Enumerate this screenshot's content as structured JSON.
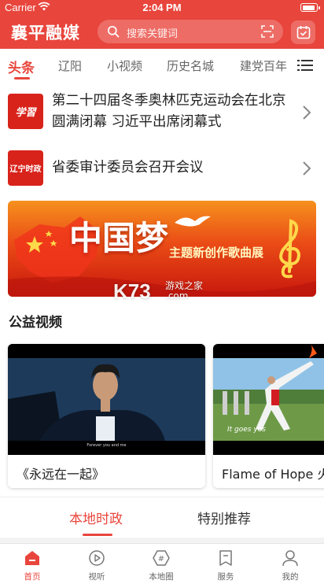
{
  "status_bar": {
    "carrier": "Carrier",
    "time": "2:04 PM"
  },
  "header": {
    "logo": "襄平融媒",
    "search_placeholder": "搜索关键词",
    "accent_color": "#e8453c"
  },
  "tabs": [
    {
      "label": "头条",
      "active": true
    },
    {
      "label": "辽阳",
      "active": false
    },
    {
      "label": "小视频",
      "active": false
    },
    {
      "label": "历史名城",
      "active": false
    },
    {
      "label": "建党百年",
      "active": false
    }
  ],
  "news": [
    {
      "thumb_text": "学習",
      "title": "第二十四届冬季奥林匹克运动会在北京圆满闭幕 习近平出席闭幕式"
    },
    {
      "thumb_text": "辽宁时政",
      "title": "省委审计委员会召开会议"
    }
  ],
  "banner": {
    "title": "中国梦",
    "subtitle": "主题新创作歌曲展",
    "watermark": "K73",
    "watermark_site_name": "游戏之家",
    "watermark_site_url": ".com"
  },
  "videos": {
    "section_title": "公益视频",
    "items": [
      {
        "title": "《永远在一起》",
        "caption": "Forever you and me"
      },
      {
        "title": "Flame of Hope 火",
        "caption": "It goes yes"
      }
    ]
  },
  "sub_tabs": [
    {
      "label": "本地时政",
      "active": true
    },
    {
      "label": "特别推荐",
      "active": false
    }
  ],
  "bottom_nav": [
    {
      "label": "首页",
      "icon": "home-icon",
      "active": true
    },
    {
      "label": "视听",
      "icon": "play-icon",
      "active": false
    },
    {
      "label": "本地圈",
      "icon": "hashtag-icon",
      "active": false
    },
    {
      "label": "服务",
      "icon": "service-icon",
      "active": false
    },
    {
      "label": "我的",
      "icon": "user-icon",
      "active": false
    }
  ]
}
